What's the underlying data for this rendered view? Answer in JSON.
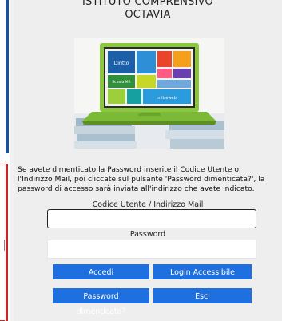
{
  "school": {
    "line1": "ISTITUTO COMPRENSIVO",
    "line2": "OCTAVIA"
  },
  "hero_image": {
    "tiles": [
      "Diritto",
      "Scuola MR",
      "mitreweb"
    ]
  },
  "info": {
    "line1": "Se avete dimenticato la Password inserite il Codice Utente o",
    "line2": "l'Indirizzo Mail, poi cliccate sul pulsante 'Password dimenticata?', la",
    "line3": "password di accesso sarà inviata all'indirizzo che avete indicato."
  },
  "form": {
    "user_label": "Codice Utente / Indirizzo Mail",
    "user_value": "",
    "password_label": "Password",
    "password_value": ""
  },
  "buttons": {
    "accedi": "Accedi",
    "login_accessibile": "Login Accessibile",
    "password_dimenticata": "Password dimenticata?",
    "esci": "Esci"
  },
  "colors": {
    "button": "#1e6fe0",
    "left_bar_top": "#1c4fa0",
    "left_bar_bottom": "#c62828",
    "laptop_body": "#8dc63f"
  }
}
